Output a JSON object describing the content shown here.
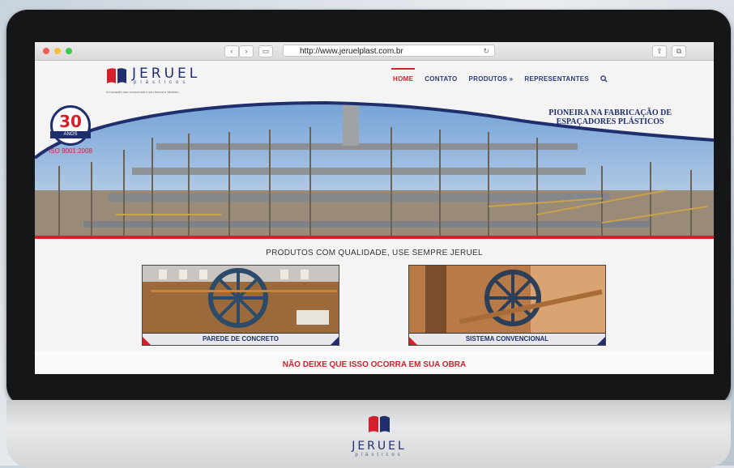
{
  "browser": {
    "url": "http://www.jeruelplast.com.br",
    "icons": [
      "back-icon",
      "forward-icon",
      "sidebar-icon",
      "reload-icon",
      "share-icon",
      "tabs-icon"
    ]
  },
  "logo": {
    "name": "JERUEL",
    "sub": "plásticos",
    "tagline": "A inovação que economiza o seu tempo e dinheiro"
  },
  "menu": {
    "items": [
      {
        "label": "HOME",
        "active": true
      },
      {
        "label": "CONTATO",
        "active": false
      },
      {
        "label": "PRODUTOS »",
        "active": false
      },
      {
        "label": "REPRESENTANTES",
        "active": false
      }
    ],
    "search_icon": "search-icon"
  },
  "hero": {
    "badge_number": "30",
    "badge_ribbon": "ANOS",
    "badge_iso": "ISO 9001:2008",
    "tagline_line1": "PIONEIRA NA FABRICAÇÃO DE",
    "tagline_line2": "ESPAÇADORES PLÁSTICOS"
  },
  "products": {
    "title": "PRODUTOS COM QUALIDADE, USE SEMPRE JERUEL",
    "cards": [
      {
        "label": "PAREDE DE CONCRETO"
      },
      {
        "label": "SISTEMA CONVENCIONAL"
      }
    ]
  },
  "warning": "NÃO DEIXE QUE ISSO OCORRA EM SUA OBRA",
  "chin": {
    "name": "JERUEL",
    "sub": "plásticos"
  },
  "colors": {
    "brand_red": "#d4202a",
    "brand_navy": "#1f2f6d"
  }
}
